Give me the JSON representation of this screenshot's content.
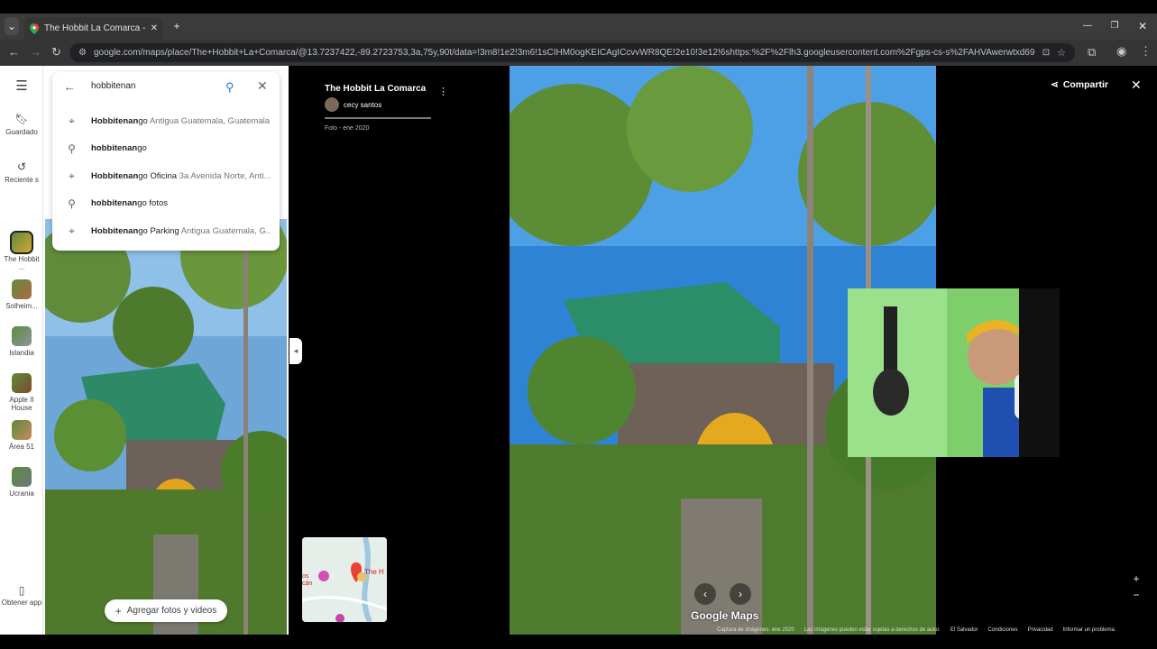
{
  "browser": {
    "tab_title": "The Hobbit La Comarca - Goog",
    "tab_close": "✕",
    "new_tab": "+",
    "url": "google.com/maps/place/The+Hobbit+La+Comarca/@13.7237422,-89.2723753,3a,75y,90t/data=!3m8!1e2!3m6!1sCIHM0ogKEICAgICcvvWR8QE!2e10!3e12!6shttps:%2F%2Flh3.googleusercontent.com%2Fgps-cs-s%2FAHVAwerwtxd69CqlRxpQbn2HoQ...",
    "minimize": "—",
    "maximize": "❐",
    "close": "✕"
  },
  "rail": {
    "menu_icon": "menu-icon",
    "saved": "Guardado",
    "recent": "Reciente s",
    "items": [
      {
        "label": "The Hobbit ...",
        "color": "#d5a534"
      },
      {
        "label": "Solheim...",
        "color": "#b06a45"
      },
      {
        "label": "Islandia",
        "color": "#8a97a0"
      },
      {
        "label": "Apple II House",
        "color": "#7b4a2c"
      },
      {
        "label": "Área 51",
        "color": "#c88860"
      },
      {
        "label": "Ucrania",
        "color": "#6e7780"
      }
    ],
    "get_app": "Obtener app"
  },
  "search": {
    "query": "hobbitenan",
    "suggestions": [
      {
        "icon": "pin-icon",
        "bold": "Hobbitenan",
        "rest": "go",
        "secondary": " Antigua Guatemala, Guatemala"
      },
      {
        "icon": "search-icon",
        "bold": "hobbitenan",
        "rest": "go",
        "secondary": ""
      },
      {
        "icon": "pin-icon",
        "bold": "Hobbitenan",
        "rest": "go Oficina",
        "secondary": " 3a Avenida Norte, Anti..."
      },
      {
        "icon": "search-icon",
        "bold": "hobbitenan",
        "rest": "go fotos",
        "secondary": ""
      },
      {
        "icon": "pin-icon",
        "bold": "Hobbitenan",
        "rest": "go Parking",
        "secondary": " Antigua Guatemala, G..."
      }
    ]
  },
  "panel": {
    "add_photos": "Agregar fotos y videos"
  },
  "viewer": {
    "place_title": "The Hobbit La Comarca",
    "author": "cecy santos",
    "photo_date": "Foto - ene 2020",
    "share": "Compartir",
    "logo": "Google Maps",
    "minimap_label": "The H",
    "minimap_label2": "os cán",
    "footer": [
      "Captura de imágenes: ene 2020",
      "Las imágenes pueden estar sujetas a derechos de autor.",
      "El Salvador",
      "Condiciones",
      "Privacidad",
      "Informar un problema"
    ]
  }
}
